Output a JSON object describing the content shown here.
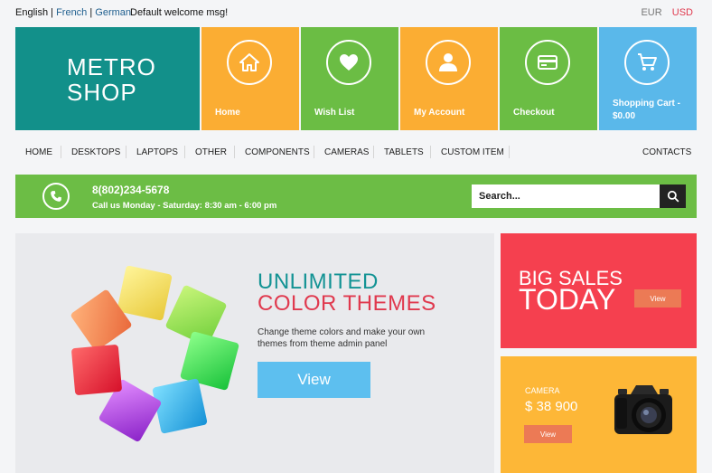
{
  "topbar": {
    "lang_selected": "English",
    "lang_sep1": "|",
    "lang_french": "French",
    "lang_sep2": "|",
    "lang_german": "German",
    "welcome": "Default welcome msg!",
    "currency_eur": "EUR",
    "currency_usd": "USD"
  },
  "logo": {
    "line1": "METRO",
    "line2": "SHOP"
  },
  "tiles": [
    {
      "label": "Home",
      "icon": "home-icon",
      "color": "#fbad33"
    },
    {
      "label": "Wish List",
      "icon": "heart-icon",
      "color": "#6bbd44"
    },
    {
      "label": "My Account",
      "icon": "user-icon",
      "color": "#fbad33"
    },
    {
      "label": "Checkout",
      "icon": "credit-card-icon",
      "color": "#6bbd44"
    },
    {
      "label": "Shopping Cart - $0.00",
      "icon": "cart-icon",
      "color": "#5ab8ea"
    }
  ],
  "nav": {
    "items": [
      "HOME",
      "DESKTOPS",
      "LAPTOPS",
      "OTHER",
      "COMPONENTS",
      "CAMERAS",
      "TABLETS",
      "CUSTOM ITEM"
    ],
    "contacts": "CONTACTS"
  },
  "contact": {
    "phone": "8(802)234-5678",
    "hours": "Call us Monday - Saturday: 8:30 am - 6:00 pm",
    "icon": "phone-icon"
  },
  "search": {
    "placeholder": "Search...",
    "icon": "search-icon"
  },
  "banner": {
    "title1": "UNLIMITED",
    "title2": "COLOR THEMES",
    "desc": "Change theme colors and make your own themes from theme admin panel",
    "button": "View"
  },
  "promo_sales": {
    "line1": "BIG SALES",
    "line2": "TODAY",
    "button": "View"
  },
  "promo_camera": {
    "label": "CAMERA",
    "price": "$ 38 900",
    "button": "View"
  },
  "colors": {
    "teal": "#12908a",
    "orange": "#fbad33",
    "green": "#6bbd44",
    "blue": "#5ab8ea",
    "red": "#f5404f",
    "accent_red": "#e0394e"
  }
}
